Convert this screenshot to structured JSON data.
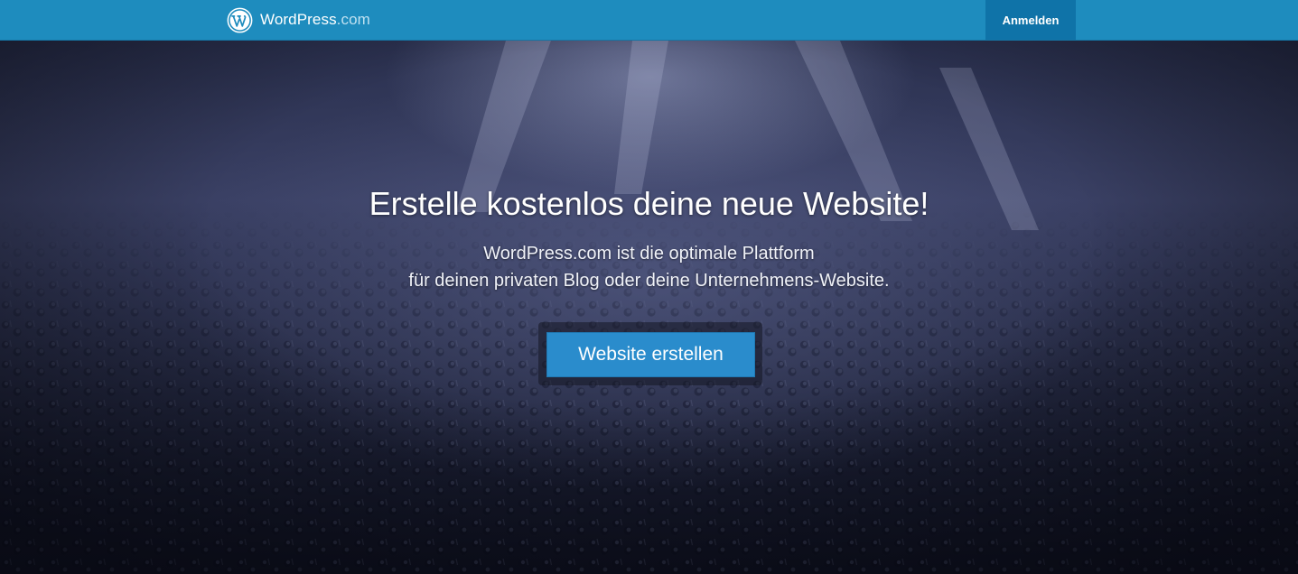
{
  "header": {
    "brand_name": "WordPress",
    "brand_tld": ".com",
    "login_label": "Anmelden"
  },
  "hero": {
    "headline": "Erstelle kostenlos deine neue Website!",
    "subline_1": "WordPress.com ist die optimale Plattform",
    "subline_2": "für deinen privaten Blog oder deine Unternehmens-Website.",
    "cta_label": "Website erstellen"
  },
  "colors": {
    "topbar": "#1e8cbe",
    "login_button": "#0f73a8",
    "cta_button": "#2a8ccc",
    "hero_dark": "#14182a"
  },
  "icons": {
    "brand_logo": "wordpress-logo-icon"
  }
}
